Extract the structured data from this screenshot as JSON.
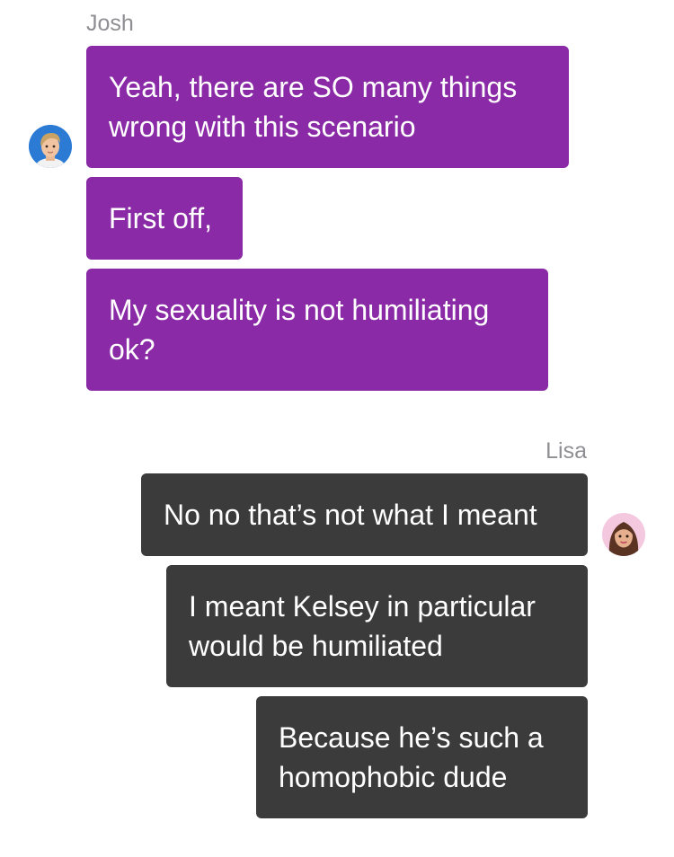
{
  "conversation": {
    "josh": {
      "name": "Josh",
      "avatar_icon": "boy-avatar-icon",
      "messages": [
        "Yeah, there are SO many things wrong with this scenario",
        "First off,",
        "My sexuality is not humiliating ok?"
      ]
    },
    "lisa": {
      "name": "Lisa",
      "avatar_icon": "girl-avatar-icon",
      "messages": [
        "No no that’s not what I meant",
        "I meant Kelsey in particular would be humiliated",
        "Because he’s such a homophobic dude"
      ]
    }
  },
  "colors": {
    "josh_bubble": "#8a2aa6",
    "lisa_bubble": "#3b3b3b",
    "sender_name": "#8e8e93"
  }
}
